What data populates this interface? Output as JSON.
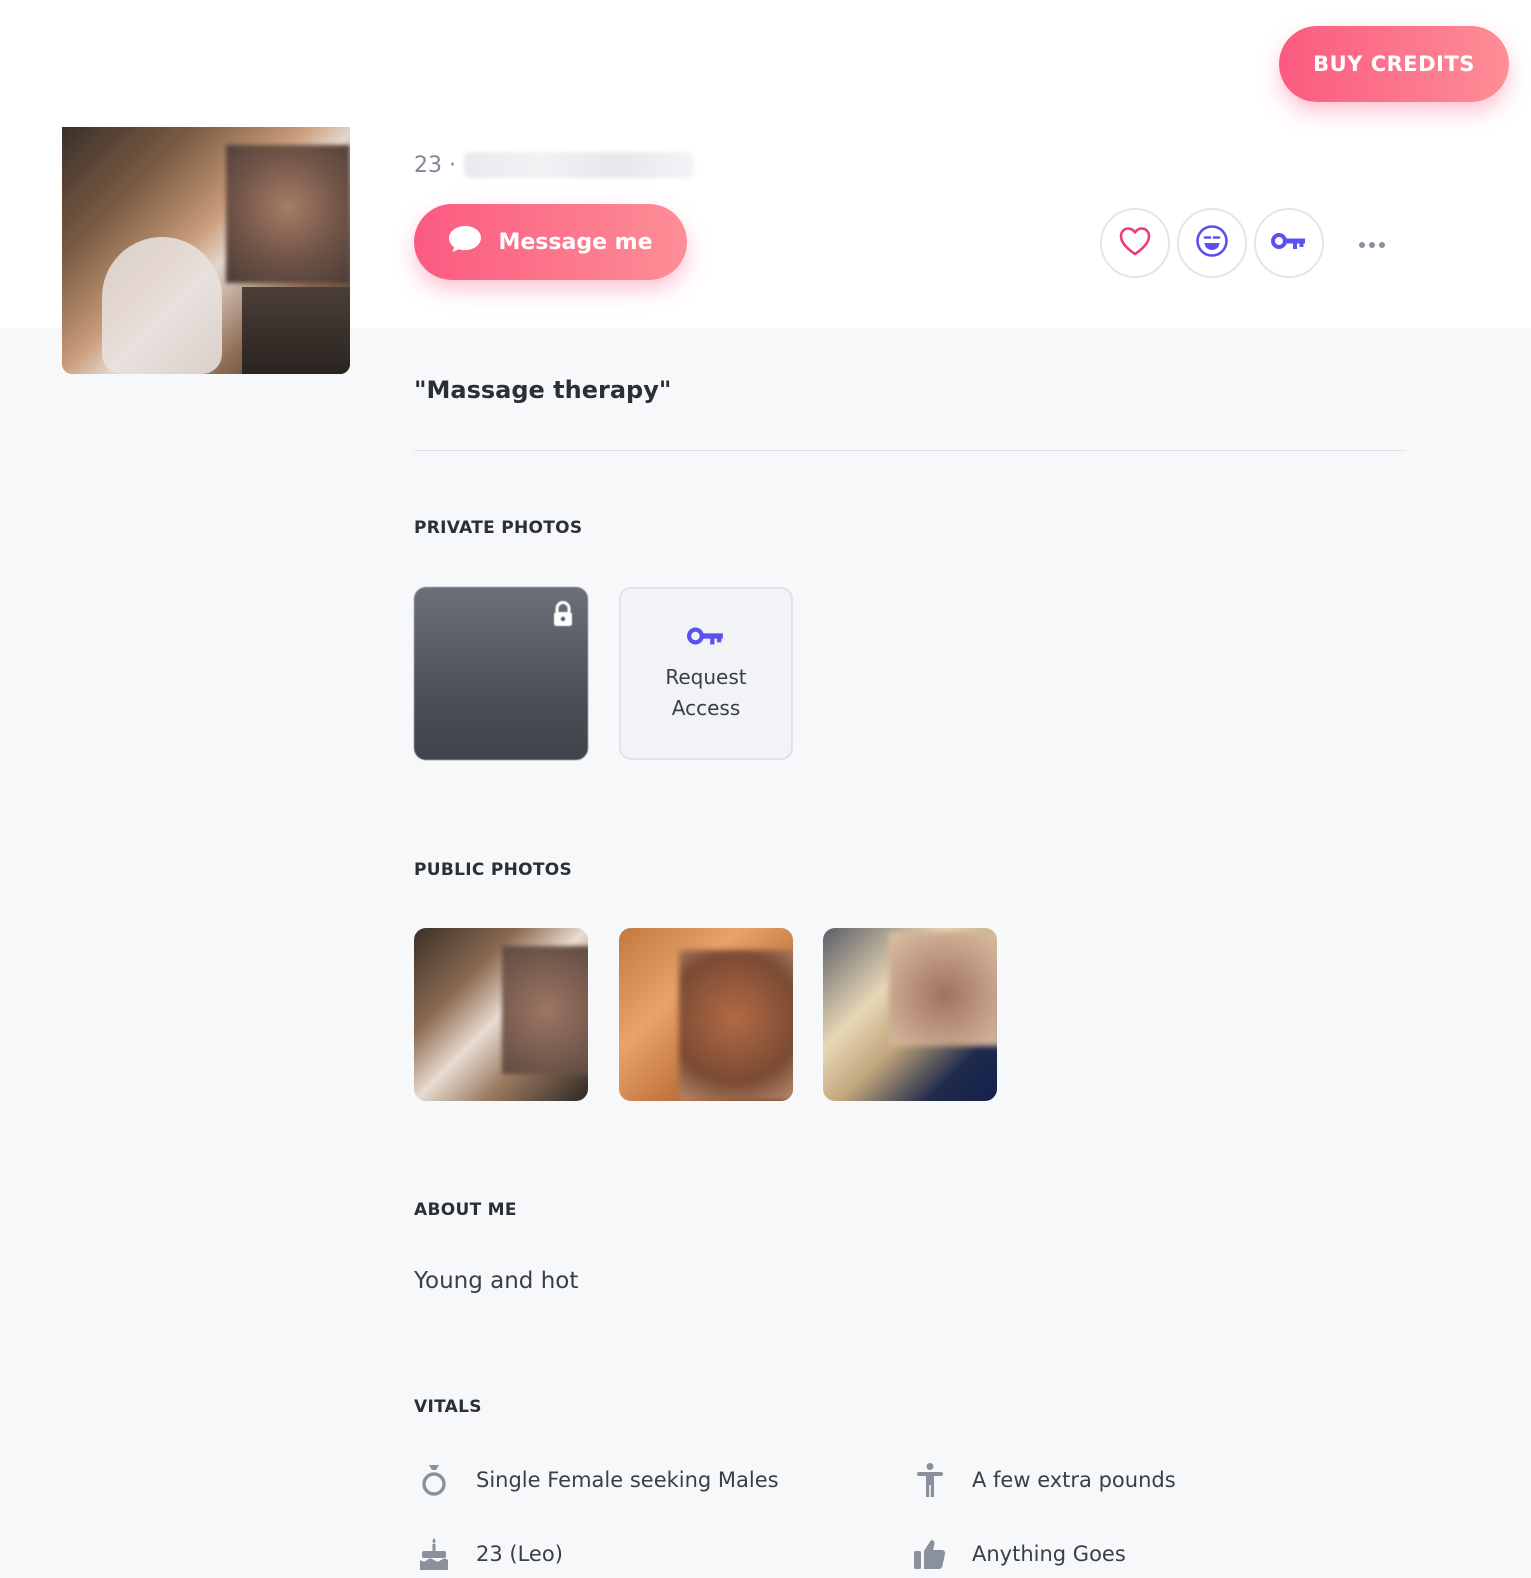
{
  "header": {
    "buy_credits_label": "BUY CREDITS"
  },
  "profile": {
    "age_prefix": "23 ·",
    "message_button_label": "Message me",
    "headline": "\"Massage therapy\""
  },
  "sections": {
    "private_photos_title": "PRIVATE PHOTOS",
    "request_access_label": "Request Access",
    "public_photos_title": "PUBLIC PHOTOS",
    "about_me_title": "ABOUT ME",
    "about_me_text": "Young and hot",
    "vitals_title": "VITALS"
  },
  "vitals": [
    {
      "icon": "ring-icon",
      "label": "Single Female seeking Males"
    },
    {
      "icon": "body-type-icon",
      "label": "A few extra pounds"
    },
    {
      "icon": "birthday-cake-icon",
      "label": "23 (Leo)"
    },
    {
      "icon": "thumbs-up-icon",
      "label": "Anything Goes"
    }
  ],
  "colors": {
    "accent_pink": "#fb5a80",
    "accent_blue": "#5b50f0",
    "heart_pink": "#f03a7a"
  }
}
